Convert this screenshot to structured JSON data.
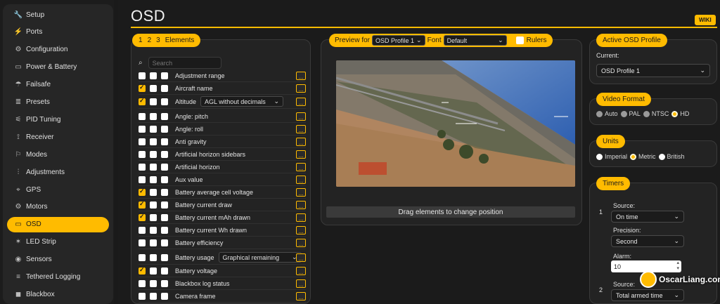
{
  "sidebar": {
    "items": [
      {
        "label": "Setup",
        "icon": "wrench-icon",
        "glyph": "🔧"
      },
      {
        "label": "Ports",
        "icon": "plug-icon",
        "glyph": "⚡"
      },
      {
        "label": "Configuration",
        "icon": "gear-icon",
        "glyph": "⚙"
      },
      {
        "label": "Power & Battery",
        "icon": "battery-icon",
        "glyph": "▭"
      },
      {
        "label": "Failsafe",
        "icon": "parachute-icon",
        "glyph": "☂"
      },
      {
        "label": "Presets",
        "icon": "preset-icon",
        "glyph": "≣"
      },
      {
        "label": "PID Tuning",
        "icon": "pid-icon",
        "glyph": "⚟"
      },
      {
        "label": "Receiver",
        "icon": "antenna-icon",
        "glyph": "⟟"
      },
      {
        "label": "Modes",
        "icon": "modes-icon",
        "glyph": "⚐"
      },
      {
        "label": "Adjustments",
        "icon": "sliders-icon",
        "glyph": "⫶"
      },
      {
        "label": "GPS",
        "icon": "satellite-icon",
        "glyph": "⌖"
      },
      {
        "label": "Motors",
        "icon": "motor-icon",
        "glyph": "⚙"
      },
      {
        "label": "OSD",
        "icon": "osd-icon",
        "glyph": "▭",
        "active": true
      },
      {
        "label": "LED Strip",
        "icon": "led-icon",
        "glyph": "✶"
      },
      {
        "label": "Sensors",
        "icon": "sensor-icon",
        "glyph": "◉"
      },
      {
        "label": "Tethered Logging",
        "icon": "logging-icon",
        "glyph": "≡"
      },
      {
        "label": "Blackbox",
        "icon": "blackbox-icon",
        "glyph": "◼"
      }
    ]
  },
  "header": {
    "title": "OSD",
    "wiki": "WIKI"
  },
  "elements_panel": {
    "tabs": [
      "1",
      "2",
      "3"
    ],
    "title": "Elements",
    "search_placeholder": "Search",
    "rows": [
      {
        "label": "Adjustment range",
        "c1": false
      },
      {
        "label": "Aircraft name",
        "c1": true
      },
      {
        "label": "Altitude",
        "c1": true,
        "select": "AGL without decimals"
      },
      {
        "label": "Angle: pitch",
        "c1": false
      },
      {
        "label": "Angle: roll",
        "c1": false
      },
      {
        "label": "Anti gravity",
        "c1": false
      },
      {
        "label": "Artificial horizon sidebars",
        "c1": false
      },
      {
        "label": "Artificial horizon",
        "c1": false
      },
      {
        "label": "Aux value",
        "c1": false
      },
      {
        "label": "Battery average cell voltage",
        "c1": true
      },
      {
        "label": "Battery current draw",
        "c1": true
      },
      {
        "label": "Battery current mAh drawn",
        "c1": true
      },
      {
        "label": "Battery current Wh drawn",
        "c1": false
      },
      {
        "label": "Battery efficiency",
        "c1": false
      },
      {
        "label": "Battery usage",
        "c1": false,
        "select": "Graphical remaining"
      },
      {
        "label": "Battery voltage",
        "c1": true
      },
      {
        "label": "Blackbox log status",
        "c1": false
      },
      {
        "label": "Camera frame",
        "c1": false
      }
    ],
    "more_label": "..."
  },
  "preview": {
    "label": "Preview for",
    "profile": "OSD Profile 1",
    "font_label": "Font",
    "font": "Default",
    "rulers": "Rulers",
    "drag_hint": "Drag elements to change position"
  },
  "active_profile": {
    "title": "Active OSD Profile",
    "current_label": "Current:",
    "current": "OSD Profile 1"
  },
  "video_format": {
    "title": "Video Format",
    "options": [
      "Auto",
      "PAL",
      "NTSC",
      "HD"
    ],
    "selected": "HD"
  },
  "units": {
    "title": "Units",
    "options": [
      "Imperial",
      "Metric",
      "British"
    ],
    "selected": "Metric"
  },
  "timers": {
    "title": "Timers",
    "timer1": {
      "index": "1",
      "source_label": "Source:",
      "source": "On time",
      "precision_label": "Precision:",
      "precision": "Second",
      "alarm_label": "Alarm:",
      "alarm": "10"
    },
    "timer2": {
      "index": "2",
      "source_label": "Source:",
      "source": "Total armed time"
    }
  },
  "watermark": "OscarLiang.com",
  "colors": {
    "accent": "#ffbb00",
    "background": "#1b1b1b",
    "panel": "#232323"
  }
}
